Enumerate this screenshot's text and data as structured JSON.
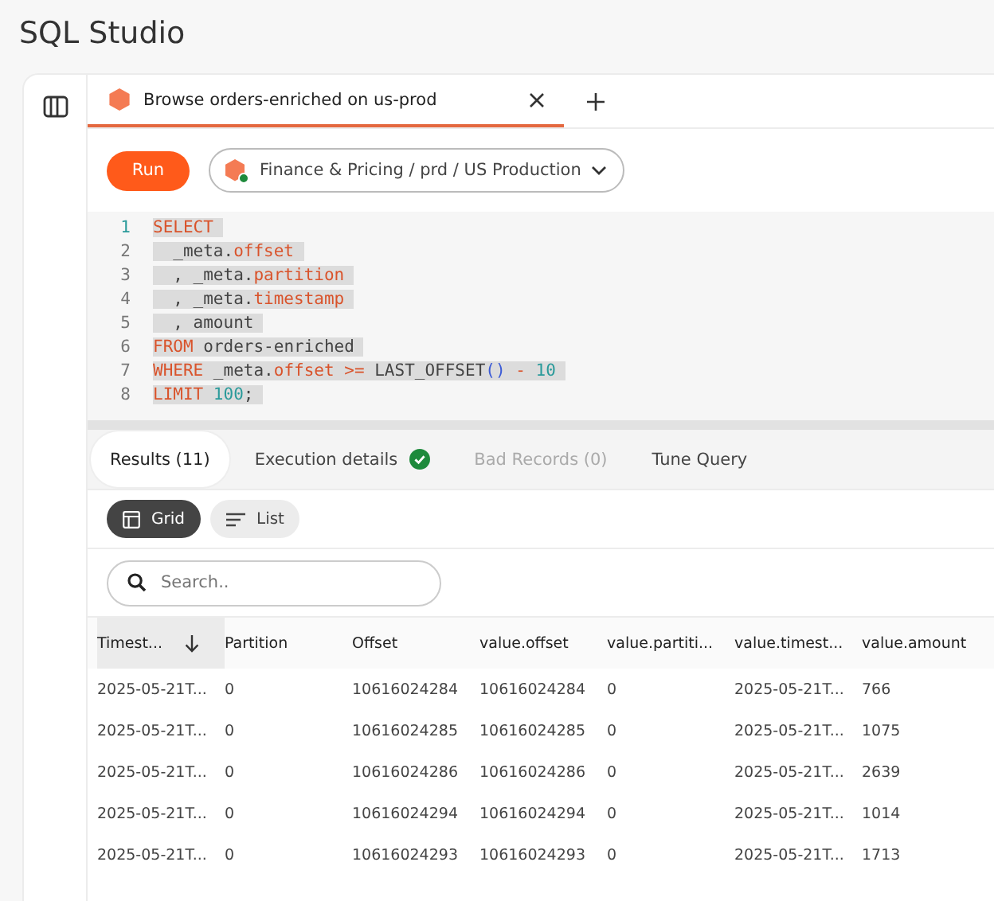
{
  "app_title": "SQL Studio",
  "tabs": [
    {
      "label": "Browse orders-enriched on us-prod",
      "selected": true
    }
  ],
  "toolbar": {
    "run_button": "Run",
    "connection": "Finance & Pricing / prd / US Production",
    "connection_online": true
  },
  "editor": {
    "lines": [
      {
        "number": "1",
        "selected": true,
        "tokens": [
          {
            "kind": "keyword",
            "text": "SELECT"
          }
        ]
      },
      {
        "number": "2",
        "selected": true,
        "tokens": [
          {
            "kind": "plain",
            "text": "  _meta."
          },
          {
            "kind": "field",
            "text": "offset"
          }
        ]
      },
      {
        "number": "3",
        "selected": true,
        "tokens": [
          {
            "kind": "plain",
            "text": "  , _meta."
          },
          {
            "kind": "field",
            "text": "partition"
          }
        ]
      },
      {
        "number": "4",
        "selected": true,
        "tokens": [
          {
            "kind": "plain",
            "text": "  , _meta."
          },
          {
            "kind": "field",
            "text": "timestamp"
          }
        ]
      },
      {
        "number": "5",
        "selected": true,
        "tokens": [
          {
            "kind": "plain",
            "text": "  , amount"
          }
        ]
      },
      {
        "number": "6",
        "selected": true,
        "tokens": [
          {
            "kind": "keyword",
            "text": "FROM"
          },
          {
            "kind": "plain",
            "text": " orders-enriched"
          }
        ]
      },
      {
        "number": "7",
        "selected": true,
        "tokens": [
          {
            "kind": "keyword",
            "text": "WHERE"
          },
          {
            "kind": "plain",
            "text": " _meta."
          },
          {
            "kind": "field",
            "text": "offset"
          },
          {
            "kind": "operator",
            "text": " >="
          },
          {
            "kind": "plain",
            "text": " LAST_OFFSET"
          },
          {
            "kind": "paren",
            "text": "()"
          },
          {
            "kind": "operator",
            "text": " -"
          },
          {
            "kind": "number",
            "text": " 10"
          }
        ]
      },
      {
        "number": "8",
        "selected": true,
        "tokens": [
          {
            "kind": "keyword",
            "text": "LIMIT"
          },
          {
            "kind": "number",
            "text": " 100"
          },
          {
            "kind": "plain",
            "text": ";"
          }
        ]
      }
    ]
  },
  "result_tabs": [
    {
      "label": "Results (11)",
      "selected": true,
      "disabled": false,
      "succeeded": false
    },
    {
      "label": "Execution details",
      "selected": false,
      "disabled": false,
      "succeeded": true
    },
    {
      "label": "Bad Records (0)",
      "selected": false,
      "disabled": true,
      "succeeded": false
    },
    {
      "label": "Tune Query",
      "selected": false,
      "disabled": false,
      "succeeded": false
    }
  ],
  "view_toggle": [
    {
      "label": "Grid",
      "kind": "grid",
      "selected": true
    },
    {
      "label": "List",
      "kind": "list",
      "selected": false
    }
  ],
  "search": {
    "placeholder": "Search.."
  },
  "table": {
    "columns": [
      {
        "label": "Timest...",
        "sorted": true
      },
      {
        "label": "Partition",
        "sorted": false
      },
      {
        "label": "Offset",
        "sorted": false
      },
      {
        "label": "value.offset",
        "sorted": false
      },
      {
        "label": "value.partiti...",
        "sorted": false
      },
      {
        "label": "value.timest...",
        "sorted": false
      },
      {
        "label": "value.amount",
        "sorted": false
      }
    ],
    "rows": [
      [
        "2025-05-21T...",
        "0",
        "10616024284",
        "10616024284",
        "0",
        "2025-05-21T...",
        "766"
      ],
      [
        "2025-05-21T...",
        "0",
        "10616024285",
        "10616024285",
        "0",
        "2025-05-21T...",
        "1075"
      ],
      [
        "2025-05-21T...",
        "0",
        "10616024286",
        "10616024286",
        "0",
        "2025-05-21T...",
        "2639"
      ],
      [
        "2025-05-21T...",
        "0",
        "10616024294",
        "10616024294",
        "0",
        "2025-05-21T...",
        "1014"
      ],
      [
        "2025-05-21T...",
        "0",
        "10616024293",
        "10616024293",
        "0",
        "2025-05-21T...",
        "1713"
      ]
    ]
  }
}
